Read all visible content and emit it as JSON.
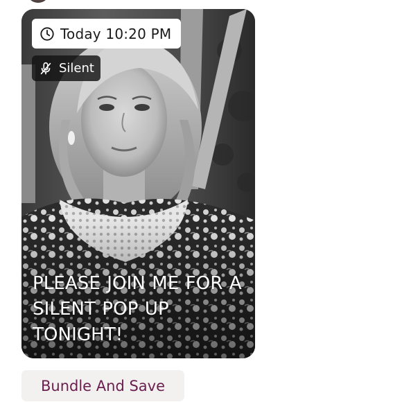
{
  "card": {
    "time_label": "Today 10:20 PM",
    "status_label": "Silent",
    "headline": "PLEASE JOIN ME FOR A SILENT POP UP TONIGHT!",
    "photo_description_icon": "portrait-photo"
  },
  "actions": {
    "bundle_label": "Bundle And Save"
  },
  "colors": {
    "bundle_text": "#6b1e4e",
    "bundle_bg": "#f3f1ef",
    "chip_dark": "#141414",
    "chip_light": "#ffffff"
  }
}
